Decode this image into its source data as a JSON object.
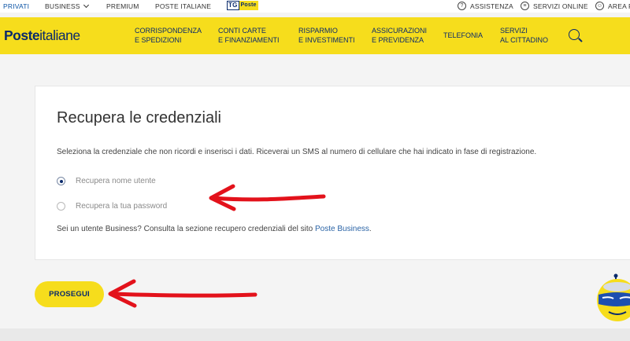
{
  "topbar": {
    "privati": "PRIVATI",
    "business": "BUSINESS",
    "premium": "PREMIUM",
    "poste_italiane": "POSTE ITALIANE",
    "tg_left": "TG",
    "tg_right": "Poste",
    "assistenza": "ASSISTENZA",
    "servizi_online": "SERVIZI ONLINE",
    "area_personale": "AREA P"
  },
  "header": {
    "logo_bold": "Poste",
    "logo_regular": "italiane",
    "nav": [
      {
        "line1": "CORRISPONDENZA",
        "line2": "E SPEDIZIONI"
      },
      {
        "line1": "CONTI CARTE",
        "line2": "E FINANZIAMENTI"
      },
      {
        "line1": "RISPARMIO",
        "line2": "E INVESTIMENTI"
      },
      {
        "line1": "ASSICURAZIONI",
        "line2": "E PREVIDENZA"
      },
      {
        "line1": "TELEFONIA",
        "line2": ""
      },
      {
        "line1": "SERVIZI",
        "line2": "AL CITTADINO"
      }
    ]
  },
  "card": {
    "title": "Recupera le credenziali",
    "description": "Seleziona la credenziale che non ricordi e inserisci i dati. Riceverai un SMS al numero di cellulare che hai indicato in fase di registrazione.",
    "options": [
      {
        "label": "Recupera nome utente",
        "checked": true
      },
      {
        "label": "Recupera la tua password",
        "checked": false
      }
    ],
    "business_text": "Sei un utente Business? Consulta la sezione recupero credenziali del sito ",
    "business_link": "Poste Business",
    "business_end": "."
  },
  "actions": {
    "proceed_label": "PROSEGUI"
  },
  "colors": {
    "brand_yellow": "#f6dd1c",
    "brand_blue": "#0a2a6b",
    "annotation_red": "#e3121b"
  }
}
